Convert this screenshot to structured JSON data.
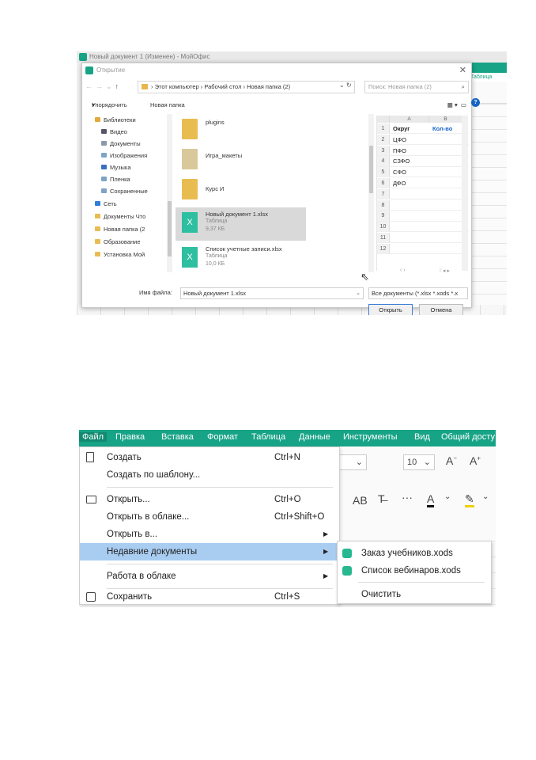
{
  "shot1": {
    "background_title": "Новый документ 1 (Изменен) - МойОфис",
    "background_tab": "Таблица",
    "dialog": {
      "title": "Открытие",
      "path": [
        "Этот компьютер",
        "Рабочий стол",
        "Новая папка (2)"
      ],
      "search_placeholder": "Поиск: Новая папка (2)",
      "organize": "Упорядочить",
      "new_folder": "Новая папка",
      "nav_items": [
        "Библиотеки",
        "Видео",
        "Документы",
        "Изображения",
        "Музыка",
        "Пленка",
        "Сохраненные",
        "Сеть",
        "Документы Что",
        "Новая папка (2",
        "Образование",
        "Установка Мой"
      ],
      "files": [
        {
          "name": "plugins",
          "type": "",
          "size": ""
        },
        {
          "name": "Игра_макеты",
          "type": "",
          "size": ""
        },
        {
          "name": "Курс И",
          "type": "",
          "size": ""
        },
        {
          "name": "Новый документ 1.xlsx",
          "type": "Таблица",
          "size": "9,37 КБ"
        },
        {
          "name": "Список учетные записи.xlsx",
          "type": "Таблица",
          "size": "10,0 КБ"
        }
      ],
      "preview": {
        "col_a": "A",
        "col_b": "B",
        "row_numbers": [
          "1",
          "2",
          "3",
          "4",
          "5",
          "6",
          "7",
          "8",
          "9",
          "10",
          "11",
          "12"
        ],
        "col_a_values": [
          "Округ",
          "ЦФО",
          "ПФО",
          "СЗФО",
          "СФО",
          "ДФО",
          "",
          "",
          "",
          "",
          "",
          ""
        ],
        "col_b_header": "Кол-во"
      },
      "filename_label": "Имя файла:",
      "filename_value": "Новый документ 1.xlsx",
      "filetype_value": "Все документы (*.xlsx *.xods *.x",
      "open_button": "Открыть",
      "cancel_button": "Отмена"
    }
  },
  "shot2": {
    "menubar": [
      "Файл",
      "Правка",
      "Вставка",
      "Формат",
      "Таблица",
      "Данные",
      "Инструменты",
      "Вид",
      "Общий досту"
    ],
    "font_size": "10",
    "file_menu": [
      {
        "label": "Создать",
        "shortcut": "Ctrl+N"
      },
      {
        "label": "Создать по шаблону...",
        "shortcut": ""
      },
      {
        "label": "Открыть...",
        "shortcut": "Ctrl+O"
      },
      {
        "label": "Открыть в облаке...",
        "shortcut": "Ctrl+Shift+O"
      },
      {
        "label": "Открыть в...",
        "shortcut": ""
      },
      {
        "label": "Недавние документы",
        "shortcut": ""
      },
      {
        "label": "Работа в облаке",
        "shortcut": ""
      },
      {
        "label": "Сохранить",
        "shortcut": "Ctrl+S"
      }
    ],
    "recent_documents": [
      "Заказ учебников.xods",
      "Список вебинаров.xods"
    ],
    "clear_label": "Очистить"
  }
}
